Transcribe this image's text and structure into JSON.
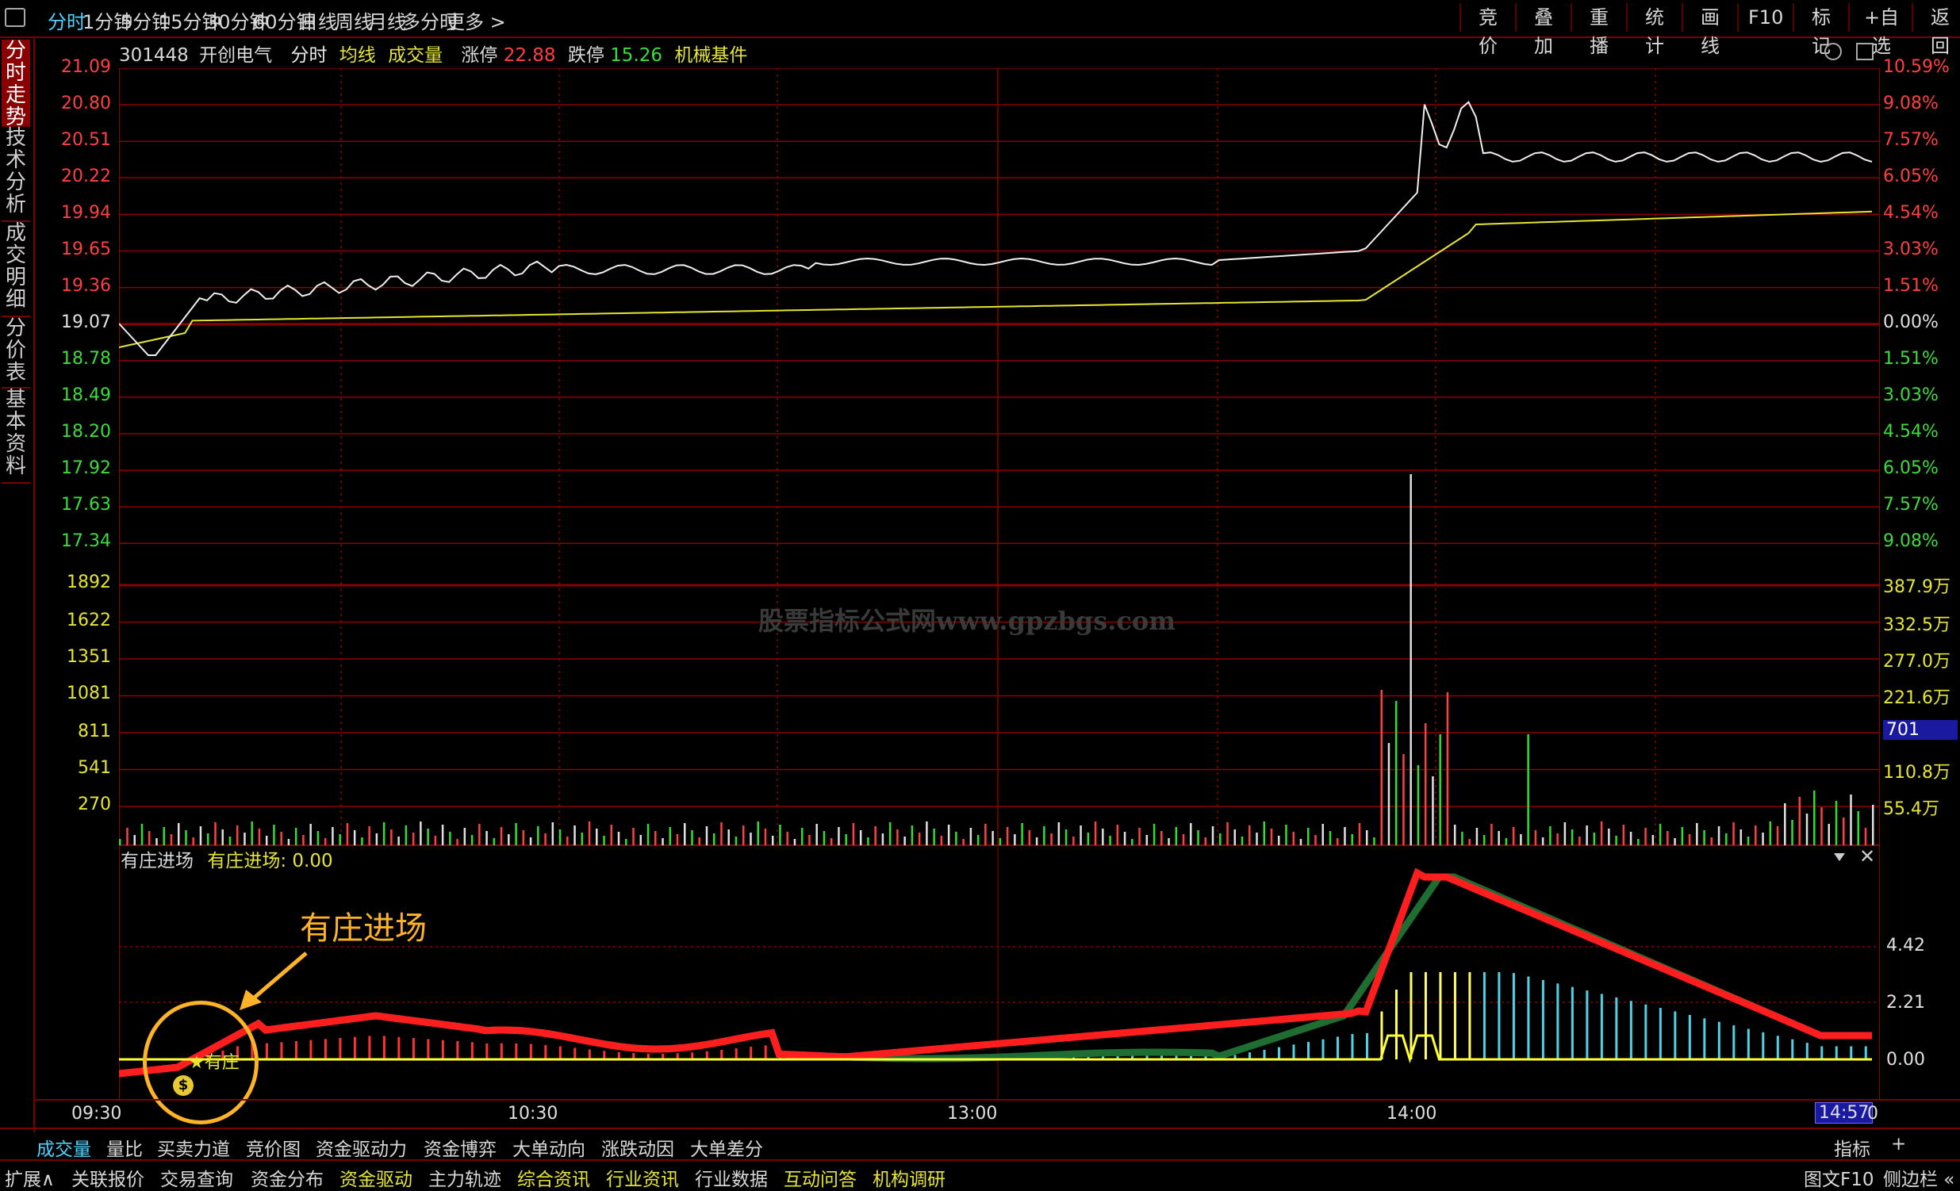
{
  "toolbar": {
    "tabs": [
      "分时",
      "1分钟",
      "5分钟",
      "15分钟",
      "30分钟",
      "60分钟",
      "日线",
      "周线",
      "月线",
      "多分时",
      "更多 >"
    ],
    "right_buttons": [
      "竞价",
      "叠加",
      "重播",
      "统计",
      "画线",
      "F10",
      "标记",
      "+自选",
      "返回"
    ]
  },
  "side_tabs": [
    "分时走势",
    "技术分析",
    "成交明细",
    "分价表",
    "基本资料"
  ],
  "header": {
    "code": "301448",
    "name": "开创电气",
    "period": "分时",
    "avg_label": "均线",
    "vol_label": "成交量",
    "limit_up_label": "涨停",
    "limit_up": "22.88",
    "limit_down_label": "跌停",
    "limit_down": "15.26",
    "sector": "机械基件"
  },
  "price_axis": {
    "left_red": [
      "21.09",
      "20.80",
      "20.51",
      "20.22",
      "19.94",
      "19.65",
      "19.36"
    ],
    "left_mid": "19.07",
    "left_green": [
      "18.78",
      "18.49",
      "18.20",
      "17.92",
      "17.63",
      "17.34"
    ],
    "right_red": [
      "10.59%",
      "9.08%",
      "7.57%",
      "6.05%",
      "4.54%",
      "3.03%",
      "1.51%"
    ],
    "right_mid": "0.00%",
    "right_green": [
      "1.51%",
      "3.03%",
      "4.54%",
      "6.05%",
      "7.57%",
      "9.08%"
    ]
  },
  "volume_axis": {
    "left": [
      "1892",
      "1622",
      "1351",
      "1081",
      "811",
      "541",
      "270"
    ],
    "right": [
      "387.9万",
      "332.5万",
      "277.0万",
      "221.6万",
      "",
      "110.8万",
      "55.4万"
    ],
    "current_badge": "701"
  },
  "watermark": "股票指标公式网www.gpzbgs.com",
  "indicator": {
    "name": "有庄进场",
    "value_label": "有庄进场: 0.00",
    "right_ticks": [
      "4.42",
      "2.21",
      "0.00"
    ],
    "annotation": "有庄进场",
    "marker_label": "有庄"
  },
  "time_axis": {
    "labels": [
      "09:30",
      "10:30",
      "13:00",
      "14:00"
    ],
    "current": "14:57",
    "end": "0"
  },
  "bottom_tabs": [
    "成交量",
    "量比",
    "买卖力道",
    "竞价图",
    "资金驱动力",
    "资金博弈",
    "大单动向",
    "涨跌动因",
    "大单差分"
  ],
  "bottom_right": [
    "指标",
    "+"
  ],
  "status_bar": {
    "items": [
      "扩展∧",
      "关联报价",
      "交易查询",
      "资金分布",
      "资金驱动",
      "主力轨迹",
      "综合资讯",
      "行业资讯",
      "行业数据",
      "互动问答",
      "机构调研"
    ],
    "right": [
      "图文F10",
      "侧边栏 «"
    ]
  },
  "colors": {
    "up": "#ff3232",
    "down": "#32dc32",
    "grid": "#8b0000",
    "accent": "#4fd2ff",
    "avg": "#e6e632"
  }
}
